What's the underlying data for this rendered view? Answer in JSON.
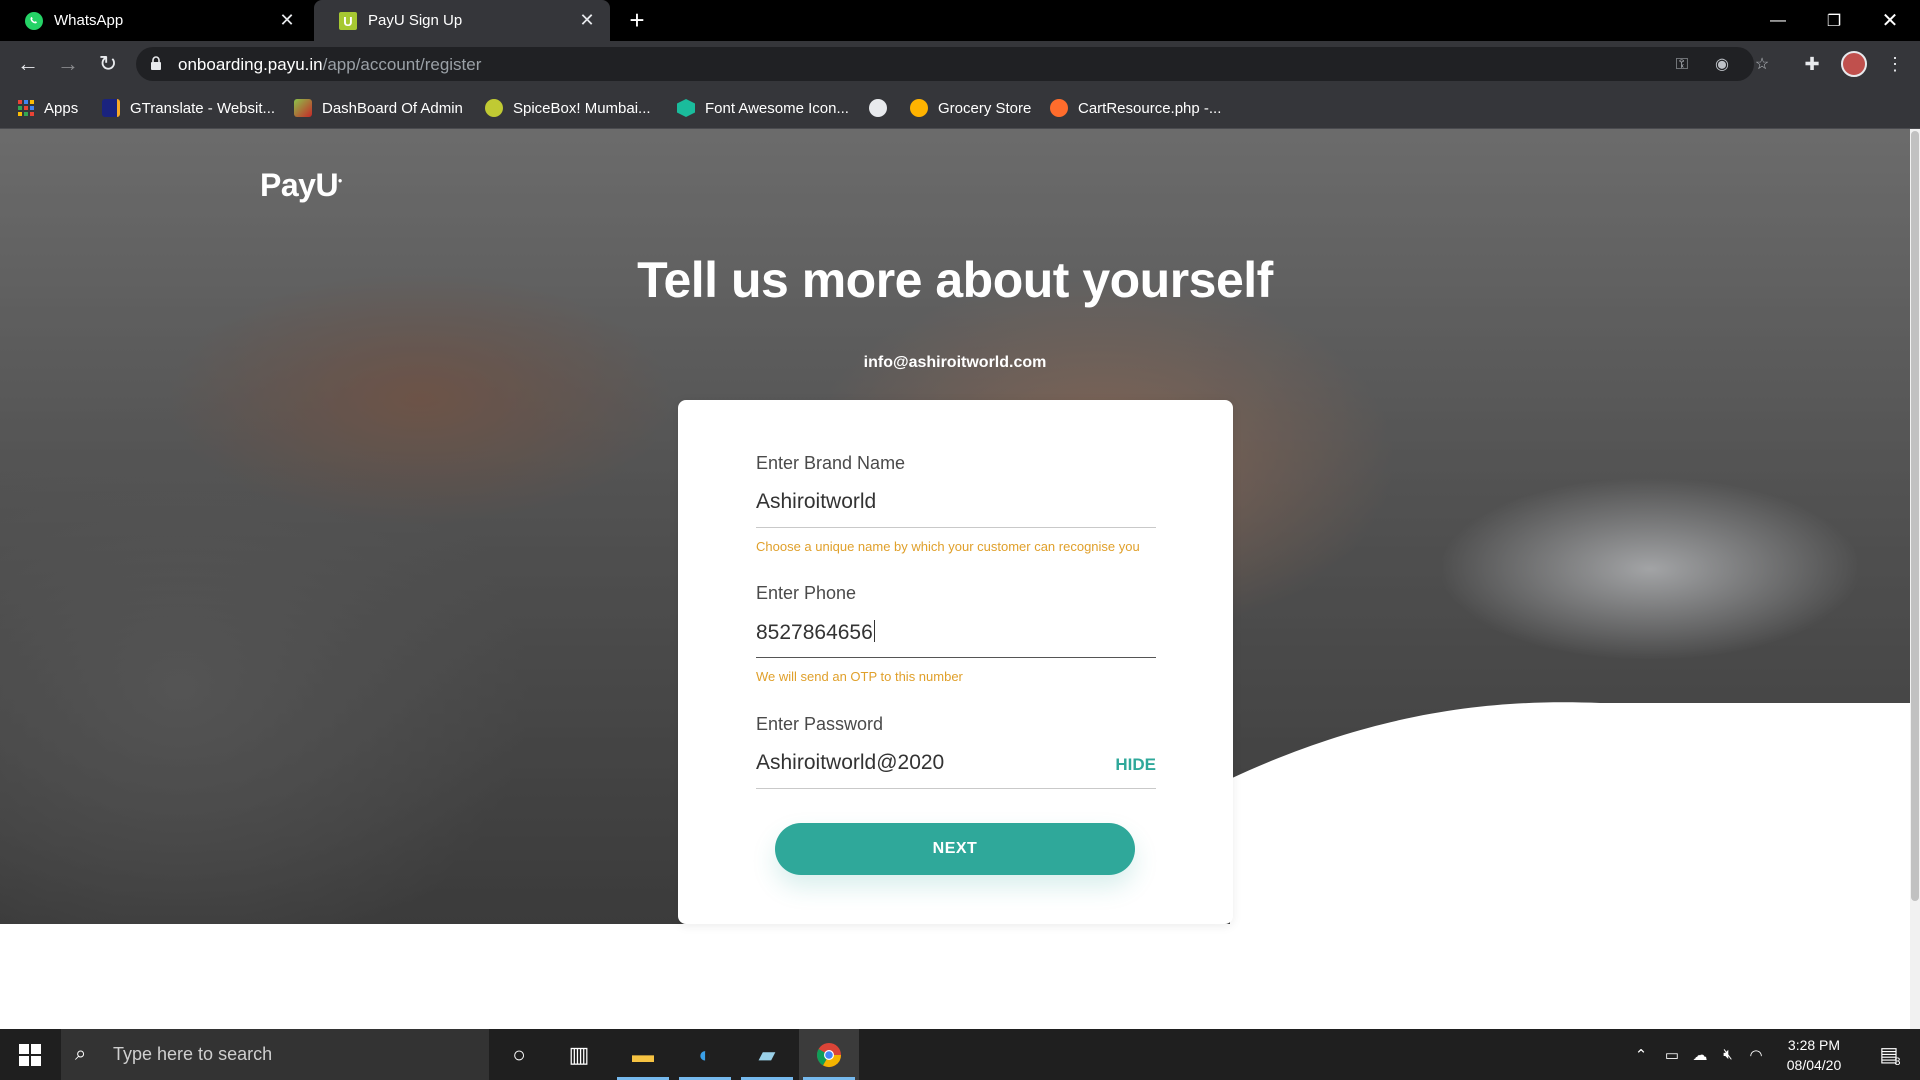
{
  "tabs": [
    {
      "title": "WhatsApp",
      "icon": "whatsapp-icon",
      "active": false
    },
    {
      "title": "PayU Sign Up",
      "icon": "payu-icon",
      "active": true
    }
  ],
  "omnibox": {
    "domain": "onboarding.payu.in",
    "path": "/app/account/register"
  },
  "bookmarks": [
    {
      "label": "Apps",
      "icon": "apps-grid-icon",
      "color": "#4285f4"
    },
    {
      "label": "GTranslate - Websit...",
      "icon": "gtranslate-icon",
      "color": "#1a237e"
    },
    {
      "label": "DashBoard Of Admin",
      "icon": "dashboard-icon",
      "color": "#8bc34a"
    },
    {
      "label": "SpiceBox! Mumbai...",
      "icon": "spicebox-icon",
      "color": "#c0ca33"
    },
    {
      "label": "Font Awesome Icon...",
      "icon": "font-awesome-icon",
      "color": "#1abc9c"
    },
    {
      "label": "",
      "icon": "globe-icon",
      "color": "#e8eaed"
    },
    {
      "label": "Grocery Store",
      "icon": "grocery-icon",
      "color": "#ffb300"
    },
    {
      "label": "CartResource.php -...",
      "icon": "cpanel-icon",
      "color": "#ff6c2c"
    }
  ],
  "page": {
    "logo": "PayU",
    "headline": "Tell us more about yourself",
    "email": "info@ashiroitworld.com",
    "form": {
      "brand": {
        "label": "Enter Brand Name",
        "value": "Ashiroitworld",
        "hint": "Choose a unique name by which your customer can recognise you"
      },
      "phone": {
        "label": "Enter Phone",
        "value": "8527864656",
        "hint": "We will send an OTP to this number"
      },
      "password": {
        "label": "Enter Password",
        "value": "Ashiroitworld@2020",
        "toggle": "HIDE"
      },
      "next_label": "NEXT"
    }
  },
  "taskbar": {
    "search_placeholder": "Type here to search",
    "time": "3:28 PM",
    "date": "08/04/20",
    "notification_count": "3"
  },
  "colors": {
    "accent": "#2fa89a",
    "hint": "#e0a02b",
    "chrome": "#35363a"
  }
}
